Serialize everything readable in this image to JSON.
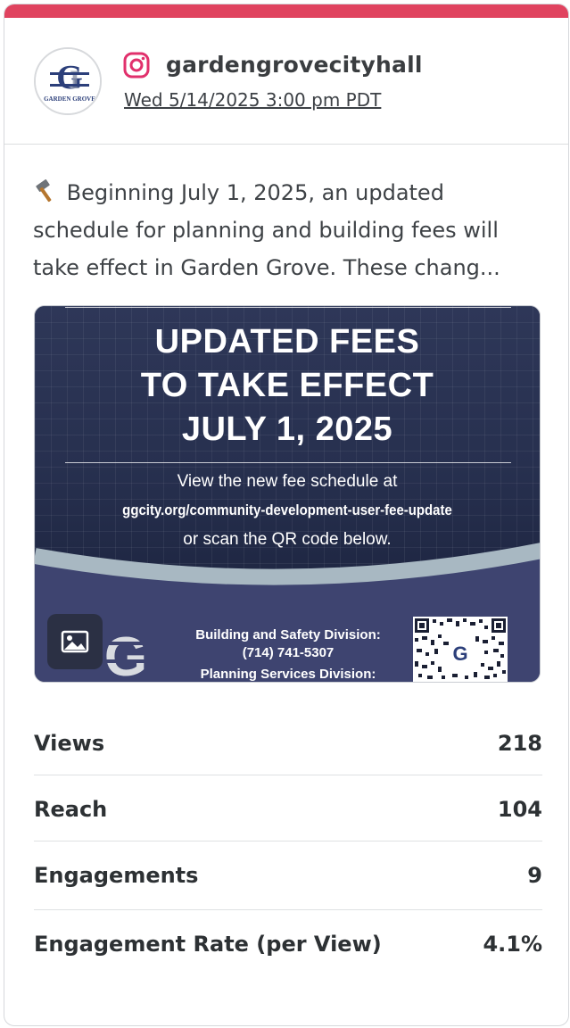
{
  "account": {
    "username": "gardengrovecityhall",
    "timestamp": "Wed 5/14/2025 3:00 pm PDT",
    "avatar_text": "GARDEN GROVE"
  },
  "post": {
    "text": "Beginning July 1, 2025, an updated schedule for planning and building fees will take effect in Garden Grove. These chang..."
  },
  "media": {
    "headline": [
      "UPDATED FEES",
      "TO TAKE EFFECT",
      "JULY 1, 2025"
    ],
    "line1": "View the new fee schedule at",
    "line2": "ggcity.org/community-development-user-fee-update",
    "line3": "or scan the QR code below.",
    "division1": "Building and Safety Division:",
    "phone1": "(714) 741-5307",
    "division2": "Planning Services Division:"
  },
  "stats": [
    {
      "label": "Views",
      "value": "218"
    },
    {
      "label": "Reach",
      "value": "104"
    },
    {
      "label": "Engagements",
      "value": "9"
    },
    {
      "label": "Engagement Rate (per View)",
      "value": "4.1%"
    }
  ],
  "colors": {
    "accent_bar": "#e0435f",
    "instagram": "#e1306c",
    "media_navy": "#2a3050"
  },
  "icons": {
    "platform": "instagram-icon",
    "emoji": "hammer-icon",
    "media_badge": "image-icon"
  }
}
